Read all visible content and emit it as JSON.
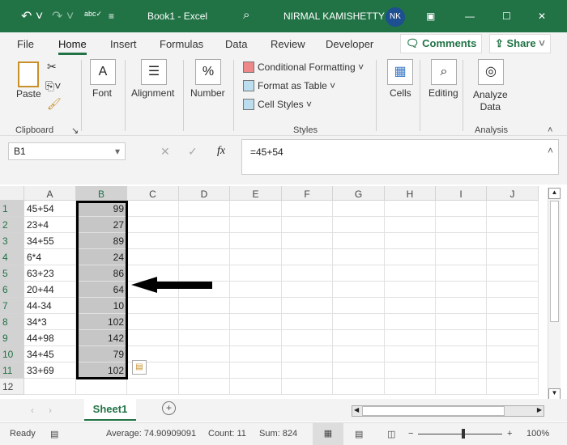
{
  "title_bar": {
    "doc_title": "Book1  -  Excel",
    "user_name": "NIRMAL KAMISHETTY",
    "user_initials": "NK"
  },
  "tabs": [
    "File",
    "Home",
    "Insert",
    "Formulas",
    "Data",
    "Review",
    "Developer"
  ],
  "active_tab": "Home",
  "comments_label": "Comments",
  "share_label": "Share",
  "ribbon": {
    "paste": "Paste",
    "clipboard": "Clipboard",
    "font": "Font",
    "alignment": "Alignment",
    "number": "Number",
    "number_icon": "%",
    "conditional_formatting": "Conditional Formatting",
    "format_as_table": "Format as Table",
    "cell_styles": "Cell Styles",
    "styles": "Styles",
    "cells": "Cells",
    "editing": "Editing",
    "analyze": "Analyze",
    "analyze2": "Data",
    "analysis": "Analysis"
  },
  "formula_bar": {
    "name_box": "B1",
    "formula": "=45+54",
    "fx": "fx"
  },
  "columns": [
    "A",
    "B",
    "C",
    "D",
    "E",
    "F",
    "G",
    "H",
    "I",
    "J"
  ],
  "rows": [
    {
      "n": "1",
      "a": "45+54",
      "b": "99"
    },
    {
      "n": "2",
      "a": "23+4",
      "b": "27"
    },
    {
      "n": "3",
      "a": "34+55",
      "b": "89"
    },
    {
      "n": "4",
      "a": "6*4",
      "b": "24"
    },
    {
      "n": "5",
      "a": "63+23",
      "b": "86"
    },
    {
      "n": "6",
      "a": "20+44",
      "b": "64"
    },
    {
      "n": "7",
      "a": "44-34",
      "b": "10"
    },
    {
      "n": "8",
      "a": "34*3",
      "b": "102"
    },
    {
      "n": "9",
      "a": "44+98",
      "b": "142"
    },
    {
      "n": "10",
      "a": "34+45",
      "b": "79"
    },
    {
      "n": "11",
      "a": "33+69",
      "b": "102"
    },
    {
      "n": "12",
      "a": "",
      "b": ""
    }
  ],
  "sheet_tab": "Sheet1",
  "status": {
    "ready": "Ready",
    "average": "Average: 74.90909091",
    "count": "Count: 11",
    "sum": "Sum: 824",
    "zoom": "100%"
  },
  "zoom_percent": 100
}
